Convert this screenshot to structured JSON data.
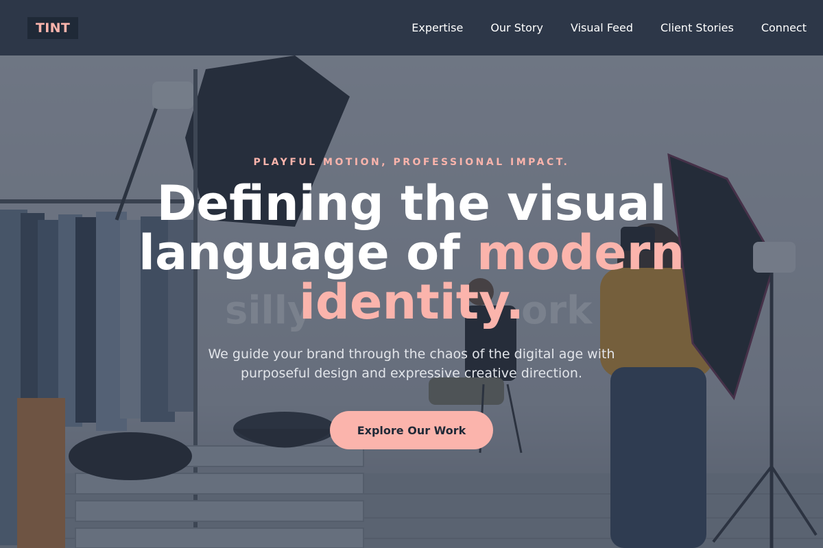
{
  "header": {
    "logo": "TINT",
    "nav": [
      "Expertise",
      "Our Story",
      "Visual Feed",
      "Client Stories",
      "Connect"
    ]
  },
  "hero": {
    "eyebrow": "PLAYFUL MOTION, PROFESSIONAL IMPACT.",
    "title_line1": "Defining the visual",
    "title_line2a": "language of ",
    "title_line2b": "modern",
    "title_line3": "identity.",
    "ghost_left": "silly",
    "ghost_right": "ork",
    "subtitle_line1": "We guide your brand through the chaos of the digital age with",
    "subtitle_line2": "purposeful design and expressive creative direction.",
    "cta": "Explore Our Work"
  },
  "colors": {
    "header_bg": "#2d3748",
    "accent": "#fbb4ac",
    "text": "#ffffff"
  }
}
